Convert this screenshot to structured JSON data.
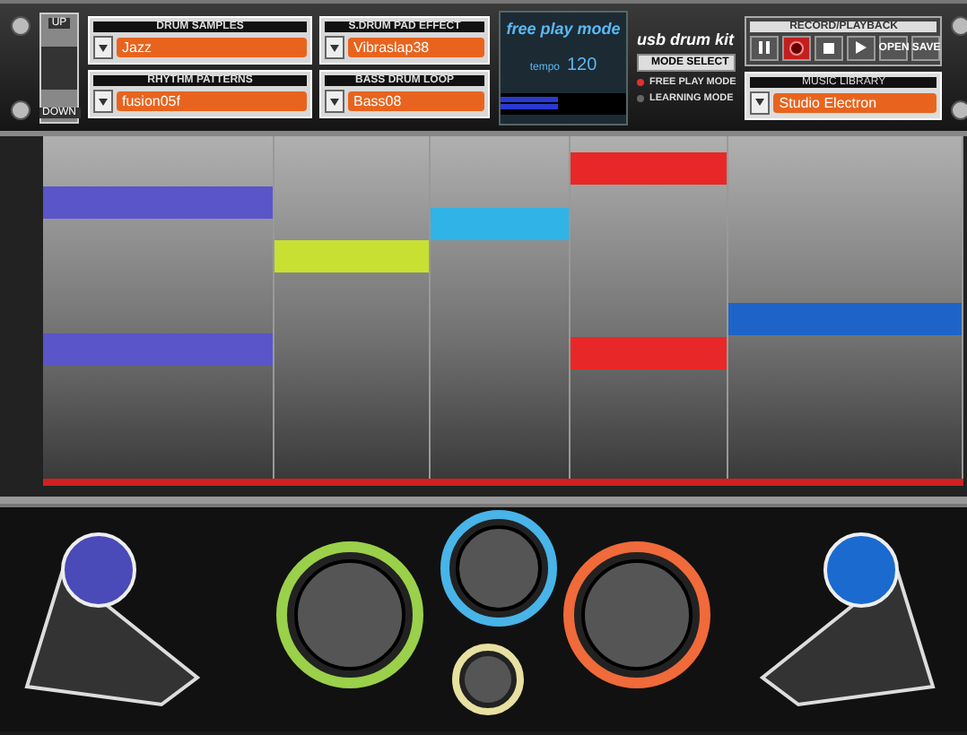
{
  "octave": {
    "up": "UP",
    "down": "DOWN"
  },
  "selectors": [
    {
      "label": "DRUM SAMPLES",
      "value": "Jazz"
    },
    {
      "label": "S.DRUM PAD EFFECT",
      "value": "Vibraslap38"
    },
    {
      "label": "RHYTHM PATTERNS",
      "value": "fusion05f"
    },
    {
      "label": "BASS DRUM LOOP",
      "value": "Bass08"
    }
  ],
  "display": {
    "mode": "free play mode",
    "tempo_label": "tempo",
    "tempo": "120",
    "level": 0.45
  },
  "brand": "usb drum kit",
  "mode_select": {
    "button": "MODE SELECT",
    "modes": [
      {
        "label": "FREE PLAY MODE",
        "selected": true
      },
      {
        "label": "LEARNING MODE",
        "selected": false
      }
    ]
  },
  "record_playback": {
    "title": "RECORD/PLAYBACK",
    "buttons": [
      {
        "kind": "pause"
      },
      {
        "kind": "record"
      },
      {
        "kind": "stop"
      },
      {
        "kind": "play"
      },
      {
        "kind": "text",
        "label": "OPEN"
      },
      {
        "kind": "text",
        "label": "SAVE"
      }
    ]
  },
  "music_library": {
    "label": "MUSIC LIBRARY",
    "value": "Studio Electron"
  },
  "lanes": [
    {
      "color": "#5a55c8"
    },
    {
      "color": "#c8e032"
    },
    {
      "color": "#30b4e8"
    },
    {
      "color": "#e82828"
    },
    {
      "color": "#1e64c8"
    }
  ],
  "pads": [
    {
      "kind": "pedal",
      "color": "#4a4ab8"
    },
    {
      "kind": "drum",
      "color": "#9ad04a"
    },
    {
      "kind": "tom",
      "color": "#48b4e8"
    },
    {
      "kind": "small",
      "color": "#e8e0a0"
    },
    {
      "kind": "drum",
      "color": "#f06a3a"
    },
    {
      "kind": "pedal",
      "color": "#1a6ad0"
    }
  ]
}
